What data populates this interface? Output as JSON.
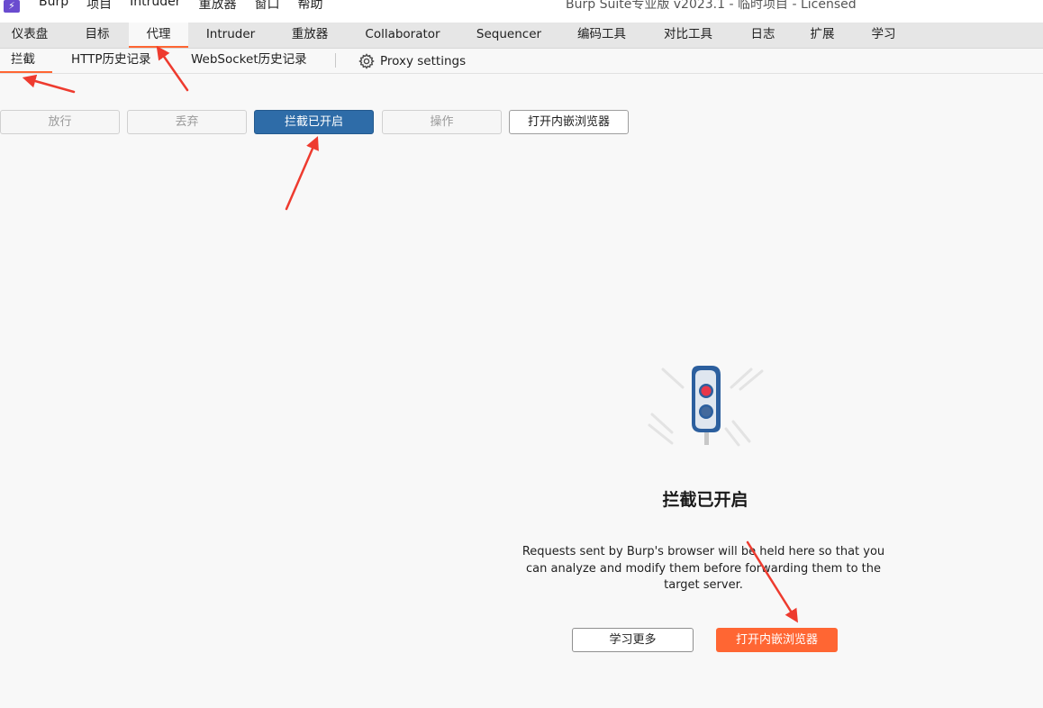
{
  "menubar": {
    "app_icon": "lightning-icon",
    "items": [
      "Burp",
      "项目",
      "Intruder",
      "重放器",
      "窗口",
      "帮助"
    ],
    "window_title": "Burp Suite专业版  v2023.1 - 临时项目 - Licensed"
  },
  "main_tabs": [
    "仪表盘",
    "目标",
    "代理",
    "Intruder",
    "重放器",
    "Collaborator",
    "Sequencer",
    "编码工具",
    "对比工具",
    "日志",
    "扩展",
    "学习"
  ],
  "main_tabs_active": "代理",
  "sub_tabs": [
    "拦截",
    "HTTP历史记录",
    "WebSocket历史记录"
  ],
  "sub_tabs_active": "拦截",
  "proxy_settings": {
    "label": "Proxy settings",
    "icon": "gear-icon"
  },
  "toolbar": {
    "forward": "放行",
    "drop": "丢弃",
    "intercept": "拦截已开启",
    "action": "操作",
    "open_browser": "打开内嵌浏览器"
  },
  "empty_state": {
    "illustration": "traffic-light-icon",
    "title": "拦截已开启",
    "description": "Requests sent by Burp's browser will be held here so that you can analyze and modify them before forwarding them to the target server.",
    "learn_more": "学习更多",
    "open_browser": "打开内嵌浏览器"
  },
  "colors": {
    "accent": "#ff6633",
    "intercept_on": "#2e6ca8",
    "annotation": "#ee3b2f"
  }
}
